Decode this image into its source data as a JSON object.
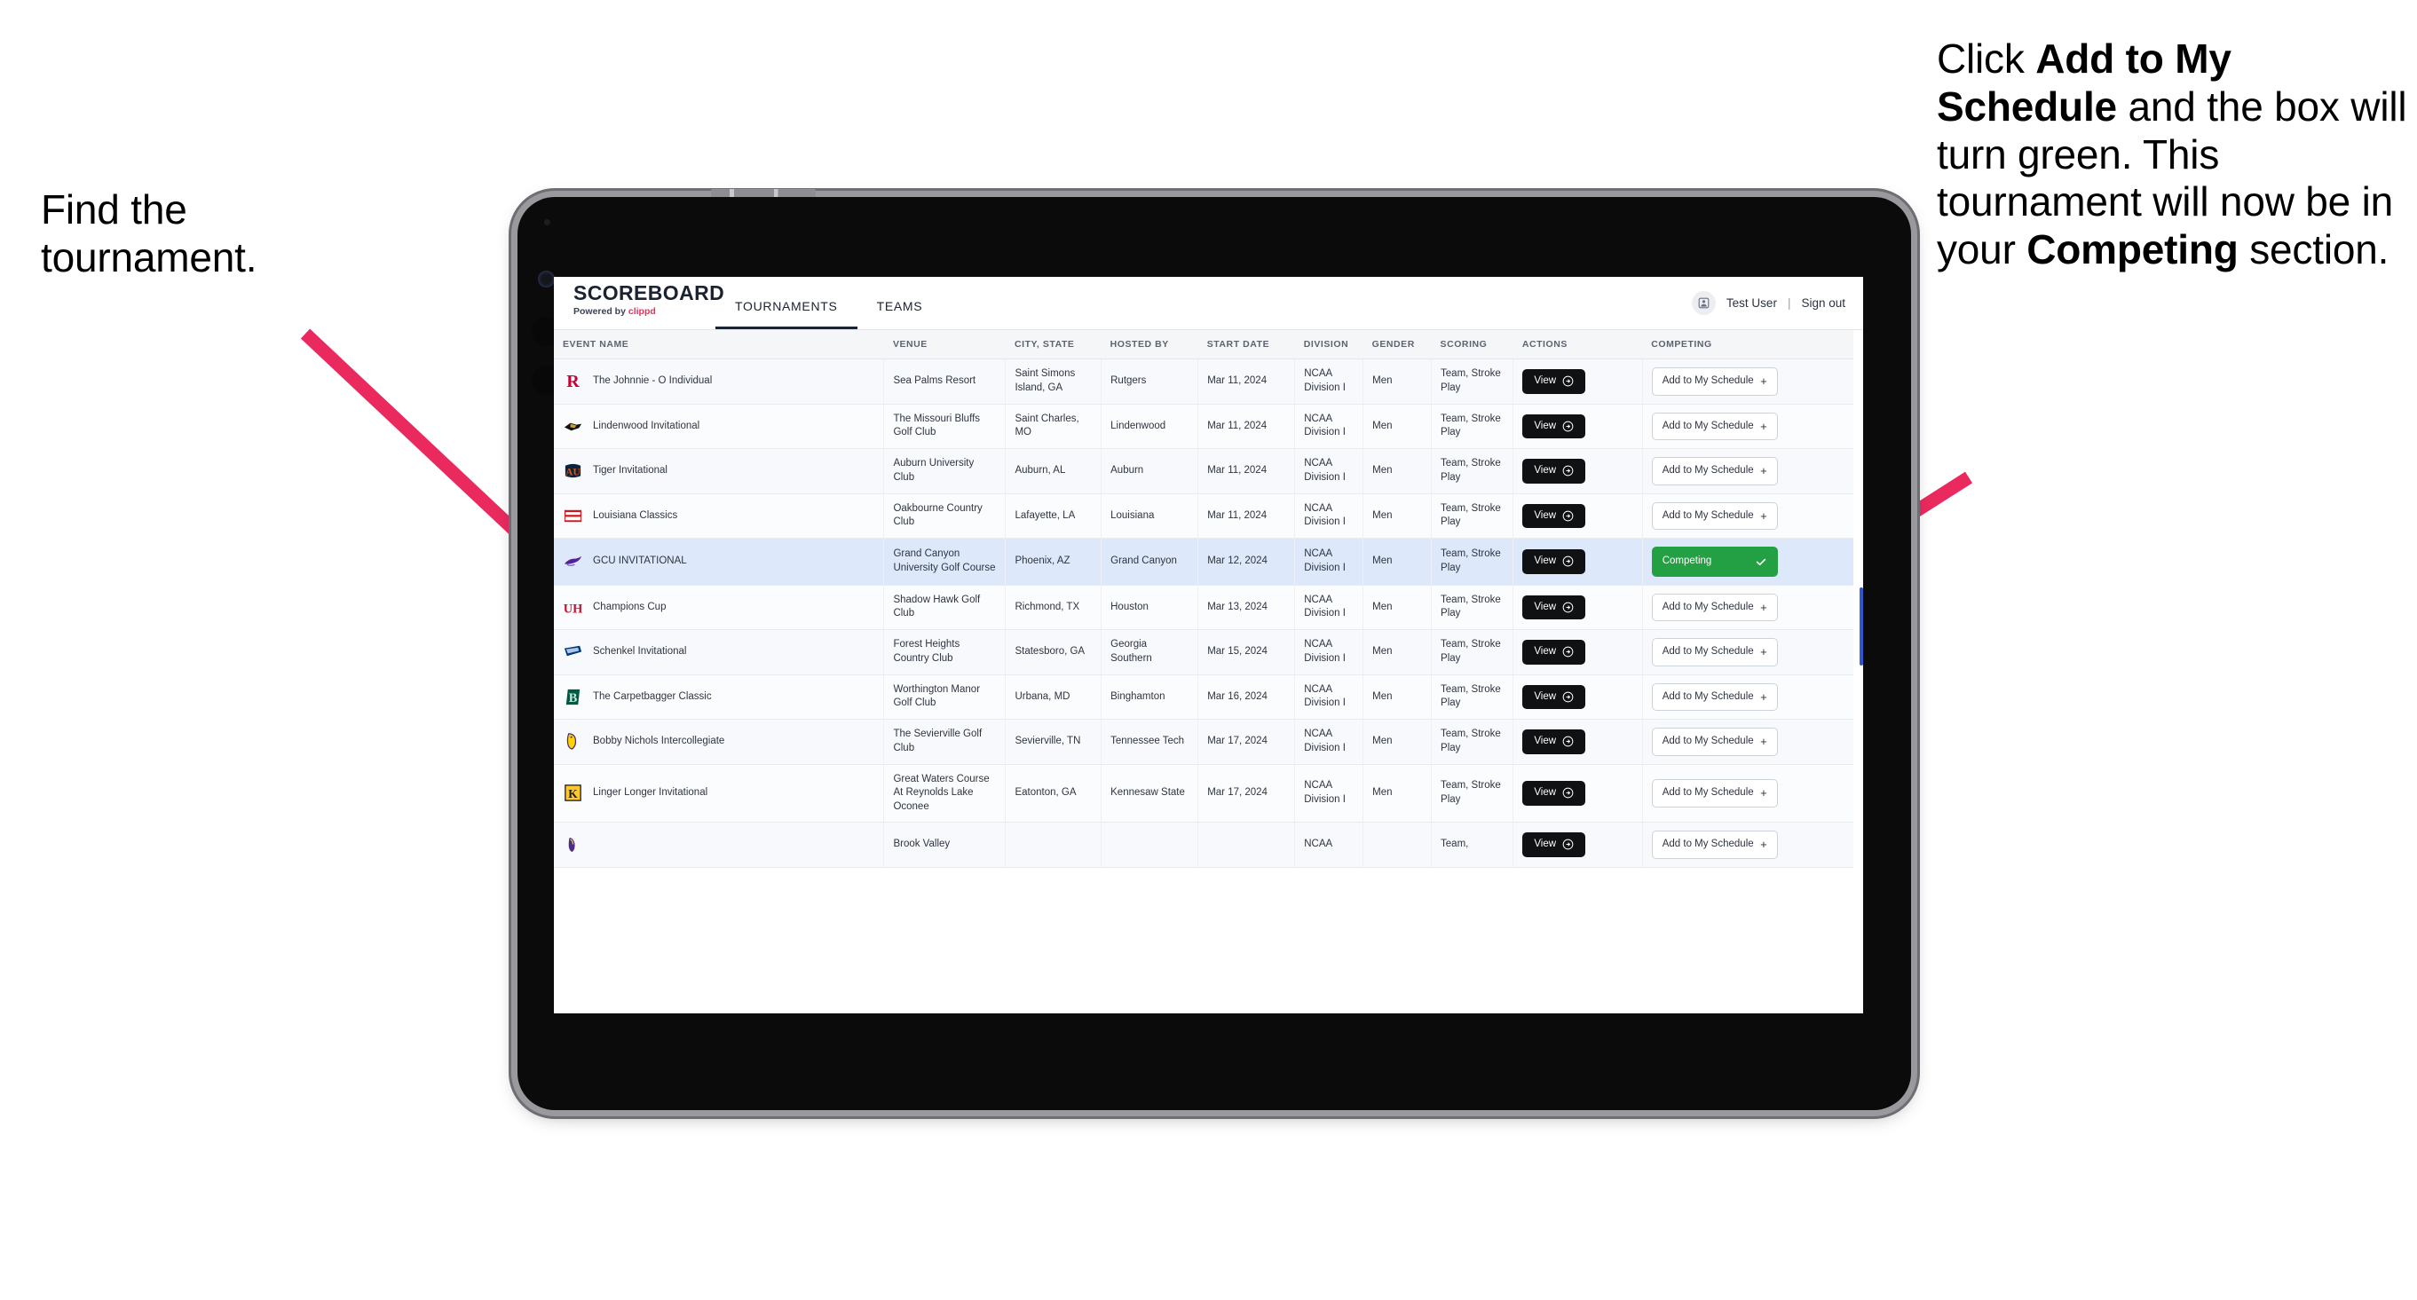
{
  "annotations": {
    "left": "Find the tournament.",
    "right_parts": [
      {
        "t": "Click ",
        "b": false
      },
      {
        "t": "Add to My Schedule",
        "b": true
      },
      {
        "t": " and the box will turn green. This tournament will now be in your ",
        "b": false
      },
      {
        "t": "Competing",
        "b": true
      },
      {
        "t": " section.",
        "b": false
      }
    ],
    "arrow_color": "#ea2a5f"
  },
  "app": {
    "brand_title": "SCOREBOARD",
    "brand_sub_prefix": "Powered by ",
    "brand_sub_name": "clippd",
    "tabs": [
      {
        "label": "TOURNAMENTS",
        "active": true
      },
      {
        "label": "TEAMS",
        "active": false
      }
    ],
    "user": "Test User",
    "separator": "|",
    "signout": "Sign out",
    "avatar_icon": "user-avatar-icon"
  },
  "table": {
    "columns": [
      "EVENT NAME",
      "VENUE",
      "CITY, STATE",
      "HOSTED BY",
      "START DATE",
      "DIVISION",
      "GENDER",
      "SCORING",
      "ACTIONS",
      "COMPETING"
    ],
    "view_label": "View",
    "add_label": "Add to My Schedule",
    "add_icon": "plus-icon",
    "competing_label": "Competing",
    "competing_icon": "check-icon",
    "rows": [
      {
        "logo": "rutgers-logo",
        "event": "The Johnnie - O Individual",
        "venue": "Sea Palms Resort",
        "city": "Saint Simons Island, GA",
        "host": "Rutgers",
        "date": "Mar 11, 2024",
        "division": "NCAA Division I",
        "gender": "Men",
        "scoring": "Team, Stroke Play",
        "competing": false
      },
      {
        "logo": "lindenwood-logo",
        "event": "Lindenwood Invitational",
        "venue": "The Missouri Bluffs Golf Club",
        "city": "Saint Charles, MO",
        "host": "Lindenwood",
        "date": "Mar 11, 2024",
        "division": "NCAA Division I",
        "gender": "Men",
        "scoring": "Team, Stroke Play",
        "competing": false
      },
      {
        "logo": "auburn-logo",
        "event": "Tiger Invitational",
        "venue": "Auburn University Club",
        "city": "Auburn, AL",
        "host": "Auburn",
        "date": "Mar 11, 2024",
        "division": "NCAA Division I",
        "gender": "Men",
        "scoring": "Team, Stroke Play",
        "competing": false
      },
      {
        "logo": "louisiana-logo",
        "event": "Louisiana Classics",
        "venue": "Oakbourne Country Club",
        "city": "Lafayette, LA",
        "host": "Louisiana",
        "date": "Mar 11, 2024",
        "division": "NCAA Division I",
        "gender": "Men",
        "scoring": "Team, Stroke Play",
        "competing": false
      },
      {
        "logo": "gcu-logo",
        "event": "GCU INVITATIONAL",
        "venue": "Grand Canyon University Golf Course",
        "city": "Phoenix, AZ",
        "host": "Grand Canyon",
        "date": "Mar 12, 2024",
        "division": "NCAA Division I",
        "gender": "Men",
        "scoring": "Team, Stroke Play",
        "competing": true
      },
      {
        "logo": "houston-logo",
        "event": "Champions Cup",
        "venue": "Shadow Hawk Golf Club",
        "city": "Richmond, TX",
        "host": "Houston",
        "date": "Mar 13, 2024",
        "division": "NCAA Division I",
        "gender": "Men",
        "scoring": "Team, Stroke Play",
        "competing": false
      },
      {
        "logo": "georgia-southern-logo",
        "event": "Schenkel Invitational",
        "venue": "Forest Heights Country Club",
        "city": "Statesboro, GA",
        "host": "Georgia Southern",
        "date": "Mar 15, 2024",
        "division": "NCAA Division I",
        "gender": "Men",
        "scoring": "Team, Stroke Play",
        "competing": false
      },
      {
        "logo": "binghamton-logo",
        "event": "The Carpetbagger Classic",
        "venue": "Worthington Manor Golf Club",
        "city": "Urbana, MD",
        "host": "Binghamton",
        "date": "Mar 16, 2024",
        "division": "NCAA Division I",
        "gender": "Men",
        "scoring": "Team, Stroke Play",
        "competing": false
      },
      {
        "logo": "tennessee-tech-logo",
        "event": "Bobby Nichols Intercollegiate",
        "venue": "The Sevierville Golf Club",
        "city": "Sevierville, TN",
        "host": "Tennessee Tech",
        "date": "Mar 17, 2024",
        "division": "NCAA Division I",
        "gender": "Men",
        "scoring": "Team, Stroke Play",
        "competing": false
      },
      {
        "logo": "kennesaw-state-logo",
        "event": "Linger Longer Invitational",
        "venue": "Great Waters Course At Reynolds Lake Oconee",
        "city": "Eatonton, GA",
        "host": "Kennesaw State",
        "date": "Mar 17, 2024",
        "division": "NCAA Division I",
        "gender": "Men",
        "scoring": "Team, Stroke Play",
        "competing": false
      },
      {
        "logo": "east-carolina-logo",
        "event": "",
        "venue": "Brook Valley",
        "city": "",
        "host": "",
        "date": "",
        "division": "NCAA",
        "gender": "",
        "scoring": "Team,",
        "competing": false
      }
    ]
  }
}
